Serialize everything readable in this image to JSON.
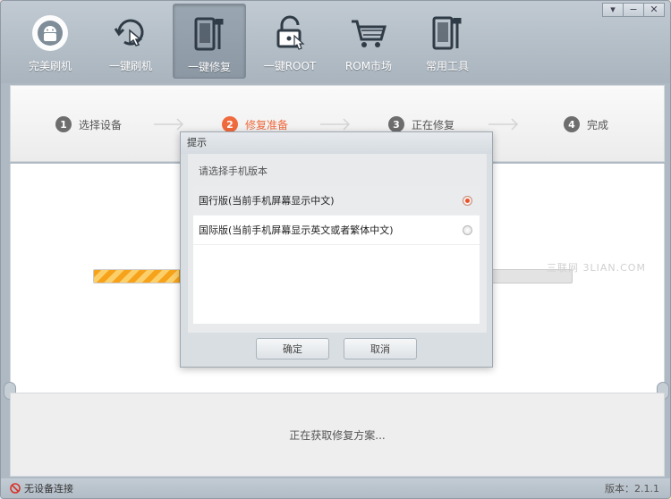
{
  "toolbar": {
    "items": [
      {
        "label": "完美刷机",
        "icon": "android-refresh-icon"
      },
      {
        "label": "一键刷机",
        "icon": "touch-refresh-icon"
      },
      {
        "label": "一键修复",
        "icon": "phone-wrench-icon",
        "active": true
      },
      {
        "label": "一键ROOT",
        "icon": "lock-icon"
      },
      {
        "label": "ROM市场",
        "icon": "cart-icon"
      },
      {
        "label": "常用工具",
        "icon": "tools-icon"
      }
    ],
    "window_controls": [
      "▾",
      "−",
      "✕"
    ]
  },
  "steps": [
    {
      "num": "1",
      "label": "选择设备"
    },
    {
      "num": "2",
      "label": "修复准备",
      "current": true
    },
    {
      "num": "3",
      "label": "正在修复"
    },
    {
      "num": "4",
      "label": "完成"
    }
  ],
  "progress": {
    "value_fraction": 0.18
  },
  "watermark": "三联网 3LIAN.COM",
  "bottom_status": "正在获取修复方案...",
  "statusbar": {
    "device": "无设备连接",
    "version": "版本：2.1.1"
  },
  "dialog": {
    "title": "提示",
    "prompt": "请选择手机版本",
    "options": [
      {
        "label": "国行版(当前手机屏幕显示中文)",
        "selected": true
      },
      {
        "label": "国际版(当前手机屏幕显示英文或者繁体中文)",
        "selected": false
      }
    ],
    "ok_label": "确定",
    "cancel_label": "取消"
  },
  "colors": {
    "accent": "#ef6a3d",
    "progress": "#f7a21b"
  }
}
